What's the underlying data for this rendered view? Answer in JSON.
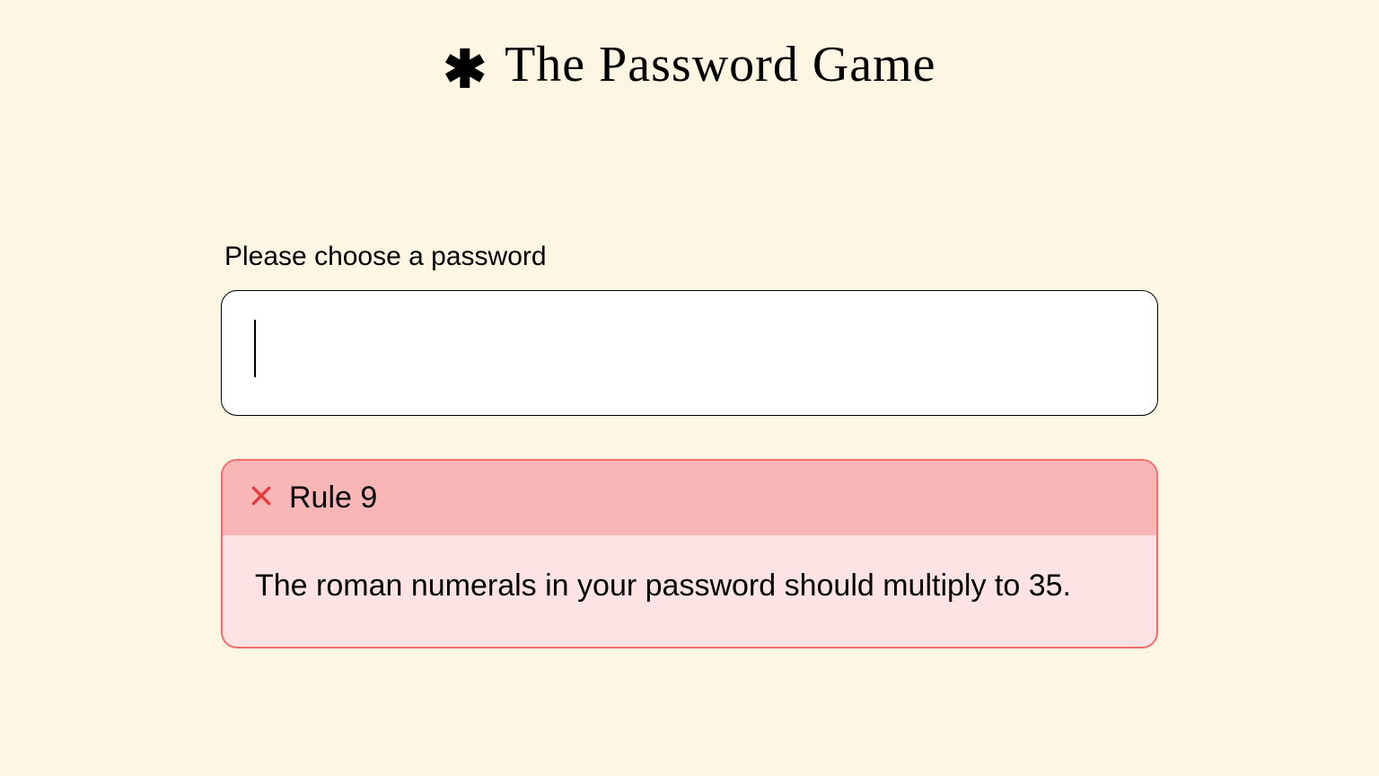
{
  "header": {
    "title": "The Password Game",
    "icon": "asterisk"
  },
  "prompt": {
    "label": "Please choose a password"
  },
  "password": {
    "value": ""
  },
  "rule": {
    "number": 9,
    "title_prefix": "Rule",
    "title": "Rule 9",
    "status": "fail",
    "icon": "x",
    "text": "The roman numerals in your password should multiply to 35."
  },
  "colors": {
    "background": "#fdf6e3",
    "rule_fail_border": "#f86b6b",
    "rule_fail_header": "#f9b6b6",
    "rule_fail_body": "#fde3e3",
    "x_icon": "#e63939"
  }
}
